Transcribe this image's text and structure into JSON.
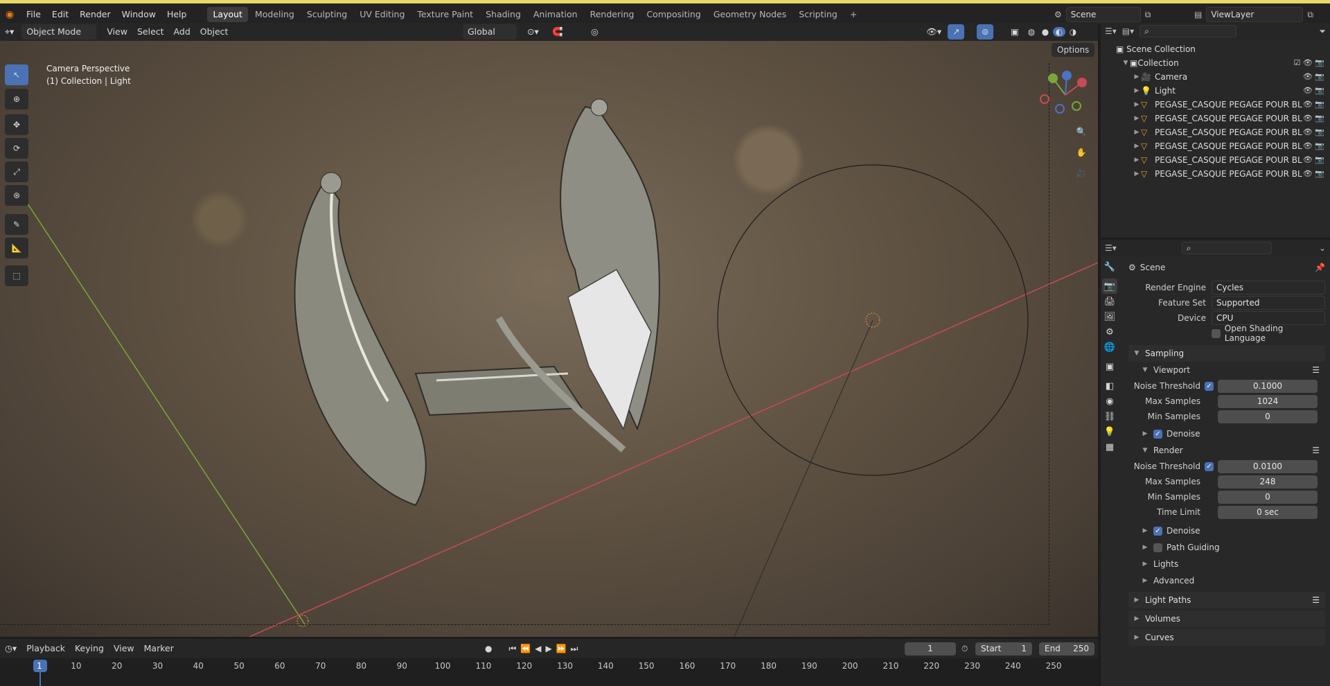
{
  "menu": [
    "File",
    "Edit",
    "Render",
    "Window",
    "Help"
  ],
  "workspaces": [
    "Layout",
    "Modeling",
    "Sculpting",
    "UV Editing",
    "Texture Paint",
    "Shading",
    "Animation",
    "Rendering",
    "Compositing",
    "Geometry Nodes",
    "Scripting"
  ],
  "active_workspace": "Layout",
  "scene_name": "Scene",
  "view_layer": "ViewLayer",
  "viewport_header": {
    "mode": "Object Mode",
    "menus": [
      "View",
      "Select",
      "Add",
      "Object"
    ],
    "transform_orientation": "Global",
    "options": "Options"
  },
  "viewport": {
    "perspective": "Camera Perspective",
    "context": "(1) Collection | Light"
  },
  "outliner": {
    "scene_collection": "Scene Collection",
    "collection": "Collection",
    "items": [
      {
        "name": "Camera",
        "icon": "camera-icon"
      },
      {
        "name": "Light",
        "icon": "light-icon"
      },
      {
        "name": "PEGASE_CASQUE PEGAGE POUR BL",
        "icon": "mesh-icon"
      },
      {
        "name": "PEGASE_CASQUE PEGAGE POUR BL",
        "icon": "mesh-icon"
      },
      {
        "name": "PEGASE_CASQUE PEGAGE POUR BL",
        "icon": "mesh-icon"
      },
      {
        "name": "PEGASE_CASQUE PEGAGE POUR BL",
        "icon": "mesh-icon"
      },
      {
        "name": "PEGASE_CASQUE PEGAGE POUR BL",
        "icon": "mesh-icon"
      },
      {
        "name": "PEGASE_CASQUE PEGAGE POUR BL",
        "icon": "mesh-icon"
      }
    ]
  },
  "properties": {
    "context_title": "Scene",
    "render_engine_label": "Render Engine",
    "render_engine": "Cycles",
    "feature_set_label": "Feature Set",
    "feature_set": "Supported",
    "device_label": "Device",
    "device": "CPU",
    "osl_label": "Open Shading Language",
    "sampling": "Sampling",
    "viewport_panel": "Viewport",
    "render_panel": "Render",
    "noise_threshold_label": "Noise Threshold",
    "max_samples_label": "Max Samples",
    "min_samples_label": "Min Samples",
    "time_limit_label": "Time Limit",
    "viewport_noise_threshold": "0.1000",
    "viewport_max_samples": "1024",
    "viewport_min_samples": "0",
    "render_noise_threshold": "0.0100",
    "render_max_samples": "248",
    "render_min_samples": "0",
    "render_time_limit": "0 sec",
    "denoise": "Denoise",
    "path_guiding": "Path Guiding",
    "lights": "Lights",
    "advanced": "Advanced",
    "light_paths": "Light Paths",
    "volumes": "Volumes",
    "curves": "Curves"
  },
  "timeline": {
    "menus": [
      "Playback",
      "Keying",
      "View",
      "Marker"
    ],
    "current_frame": "1",
    "start_label": "Start",
    "start": "1",
    "end_label": "End",
    "end": "250",
    "ticks": [
      "1",
      "10",
      "20",
      "30",
      "40",
      "50",
      "60",
      "70",
      "80",
      "90",
      "100",
      "110",
      "120",
      "130",
      "140",
      "150",
      "160",
      "170",
      "180",
      "190",
      "200",
      "210",
      "220",
      "230",
      "240",
      "250"
    ]
  },
  "colors": {
    "accent": "#4a72b5",
    "title_strip": "#e9d86a",
    "x_axis": "#c84a56",
    "y_axis": "#7aa63b"
  }
}
